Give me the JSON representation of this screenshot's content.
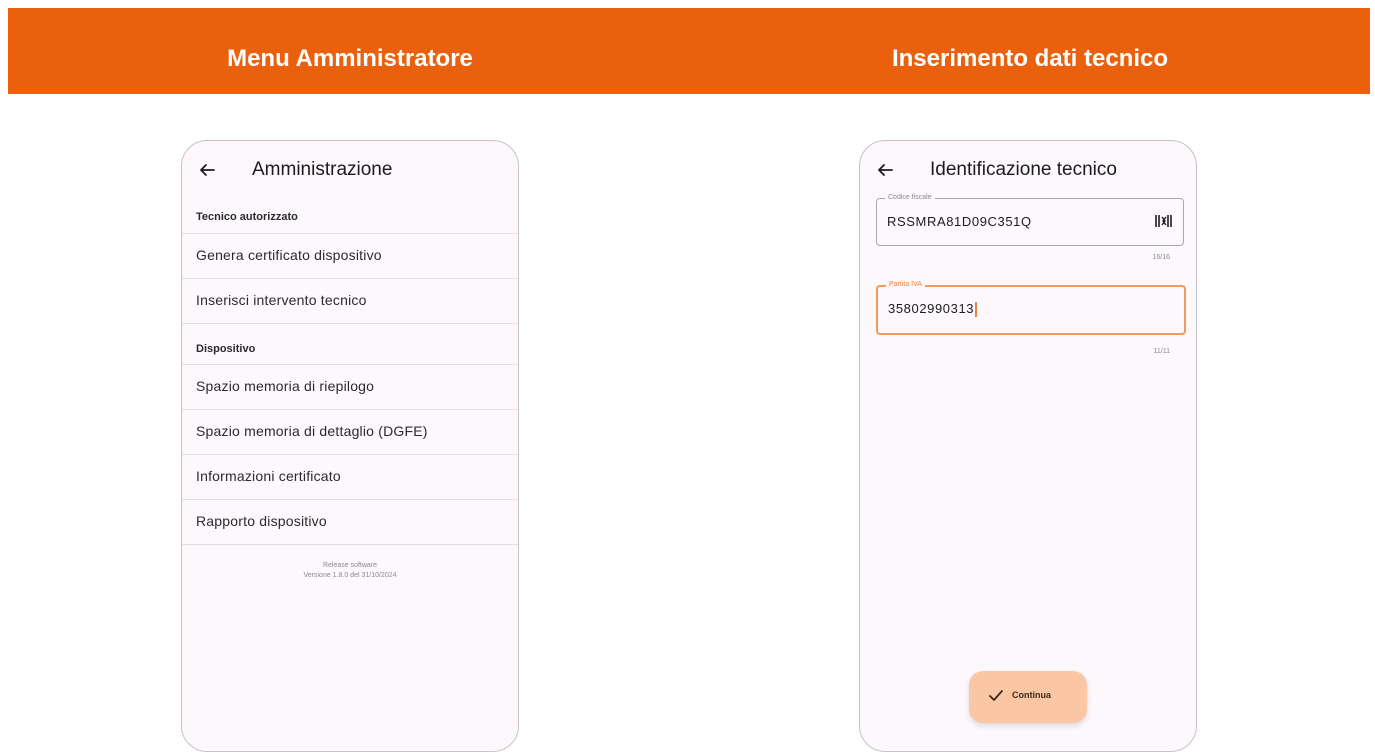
{
  "colors": {
    "banner": "#ea600c",
    "banner_text": "#ffffff",
    "phone_bg": "#fdf8fb",
    "focus_accent": "#f19a5e",
    "fab_bg": "#fbc6a4"
  },
  "banner": {
    "left_title": "Menu Amministratore",
    "right_title": "Inserimento dati tecnico"
  },
  "admin_screen": {
    "back_icon": "arrow-left-icon",
    "title": "Amministrazione",
    "sections": [
      {
        "header": "Tecnico autorizzato",
        "items": [
          "Genera certificato dispositivo",
          "Inserisci intervento tecnico"
        ]
      },
      {
        "header": "Dispositivo",
        "items": [
          "Spazio memoria di riepilogo",
          "Spazio memoria di dettaglio (DGFE)",
          "Informazioni certificato",
          "Rapporto dispositivo"
        ]
      }
    ],
    "release_label": "Release software",
    "release_version": "Versione 1.8.0 del 31/10/2024"
  },
  "tech_screen": {
    "back_icon": "arrow-left-icon",
    "title": "Identificazione tecnico",
    "fields": [
      {
        "label": "Codice fiscale",
        "value": "RSSMRA81D09C351Q",
        "counter": "16/16",
        "icon": "barcode-scan-icon"
      },
      {
        "label": "Partita IVA",
        "value": "35802990313",
        "counter": "11/11"
      }
    ],
    "continue_button": {
      "label": "Continua",
      "icon": "check-icon"
    }
  }
}
